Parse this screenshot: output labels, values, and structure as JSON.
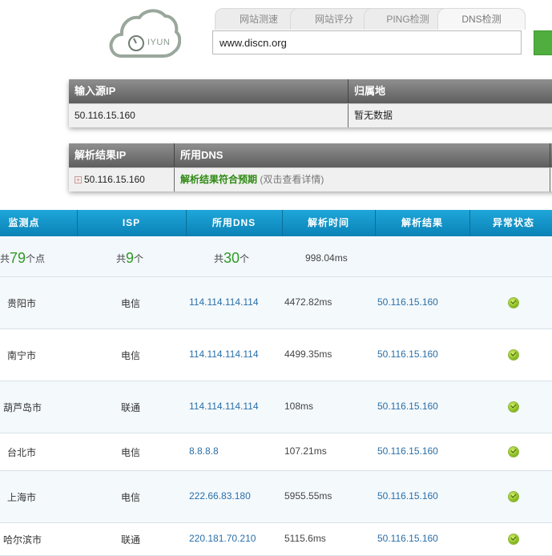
{
  "logo": {
    "text": "IYUN"
  },
  "tabs": [
    {
      "label": "网站测速"
    },
    {
      "label": "网站评分"
    },
    {
      "label": "PING检测"
    },
    {
      "label": "DNS检测"
    }
  ],
  "search": {
    "value": "www.discn.org"
  },
  "ip_panel": {
    "headers": [
      "输入源IP",
      "归属地"
    ],
    "row": {
      "ip": "50.116.15.160",
      "location": "暂无数据"
    }
  },
  "resolve_panel": {
    "headers": [
      "解析结果IP",
      "所用DNS"
    ],
    "row": {
      "ip": "50.116.15.160",
      "status": "解析结果符合预期",
      "hint": "(双击查看详情)"
    }
  },
  "table": {
    "headers": [
      "监测点",
      "ISP",
      "所用DNS",
      "解析时间",
      "解析结果",
      "异常状态"
    ],
    "summary": {
      "nodes_prefix": "共",
      "nodes_count": "79",
      "nodes_suffix": "个点",
      "isp_prefix": "共",
      "isp_count": "9",
      "isp_suffix": "个",
      "dns_prefix": "共",
      "dns_count": "30",
      "dns_suffix": "个",
      "avg_time": "998.04ms"
    },
    "rows": [
      {
        "city": "贵阳市",
        "isp": "电信",
        "dns": "114.114.114.114",
        "time": "4472.82ms",
        "result": "50.116.15.160",
        "status": "ok"
      },
      {
        "city": "南宁市",
        "isp": "电信",
        "dns": "114.114.114.114",
        "time": "4499.35ms",
        "result": "50.116.15.160",
        "status": "ok"
      },
      {
        "city": "葫芦岛市",
        "isp": "联通",
        "dns": "114.114.114.114",
        "time": "108ms",
        "result": "50.116.15.160",
        "status": "ok"
      },
      {
        "city": "台北市",
        "isp": "电信",
        "dns": "8.8.8.8",
        "time": "107.21ms",
        "result": "50.116.15.160",
        "status": "ok"
      },
      {
        "city": "上海市",
        "isp": "电信",
        "dns": "222.66.83.180",
        "time": "5955.55ms",
        "result": "50.116.15.160",
        "status": "ok"
      },
      {
        "city": "哈尔滨市",
        "isp": "联通",
        "dns": "220.181.70.210",
        "time": "5115.6ms",
        "result": "50.116.15.160",
        "status": "ok"
      }
    ]
  }
}
